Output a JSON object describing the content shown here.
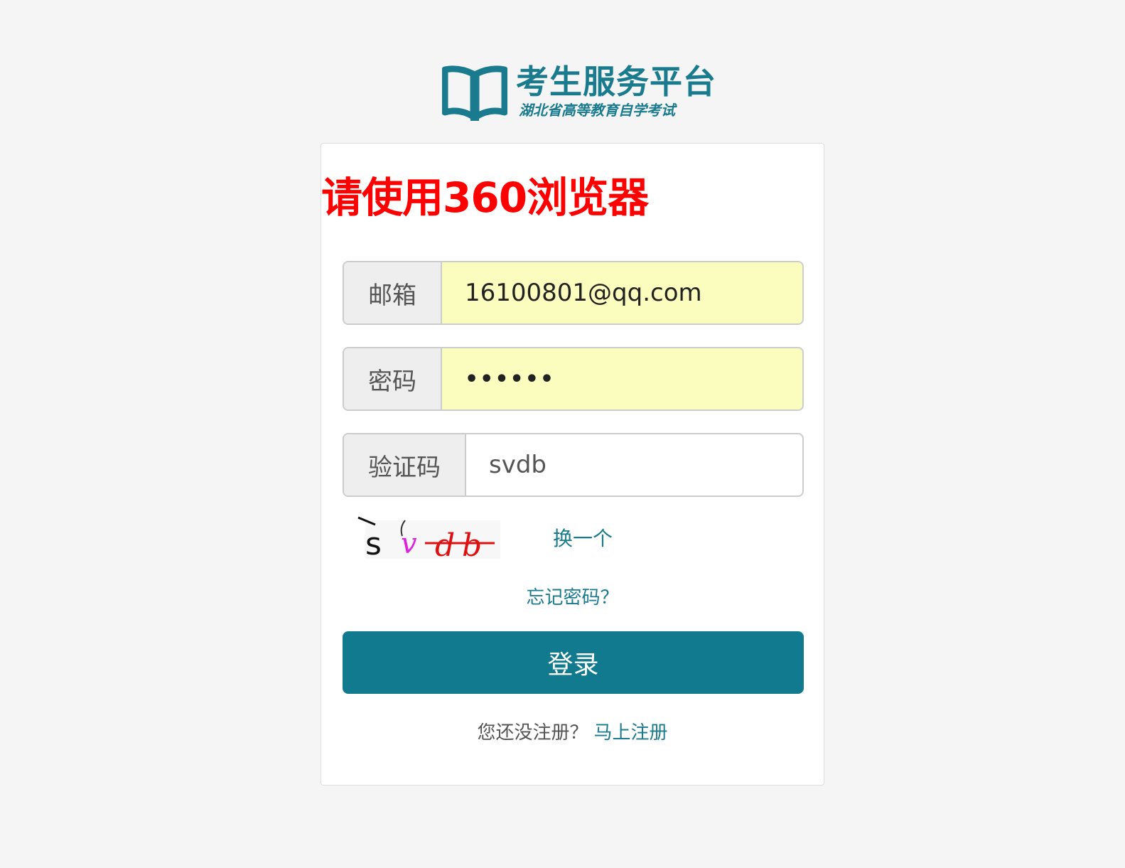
{
  "logo": {
    "title": "考生服务平台",
    "subtitle": "湖北省高等教育自学考试",
    "icon": "open-book-icon",
    "color": "#1a7b8e"
  },
  "notice": "请使用360浏览器",
  "form": {
    "email": {
      "label": "邮箱",
      "value": "16100801@qq.com"
    },
    "password": {
      "label": "密码",
      "value": "••••••"
    },
    "captcha": {
      "label": "验证码",
      "value": "svdb"
    },
    "captcha_image_text": "svdb",
    "refresh_label": "换一个",
    "forgot_label": "忘记密码？",
    "login_label": "登录"
  },
  "register": {
    "prompt": "您还没注册？",
    "link": "马上注册"
  },
  "colors": {
    "brand": "#117a8e",
    "notice": "#ff0000",
    "autofill": "#fafdbe",
    "page_bg": "#f5f5f5"
  }
}
